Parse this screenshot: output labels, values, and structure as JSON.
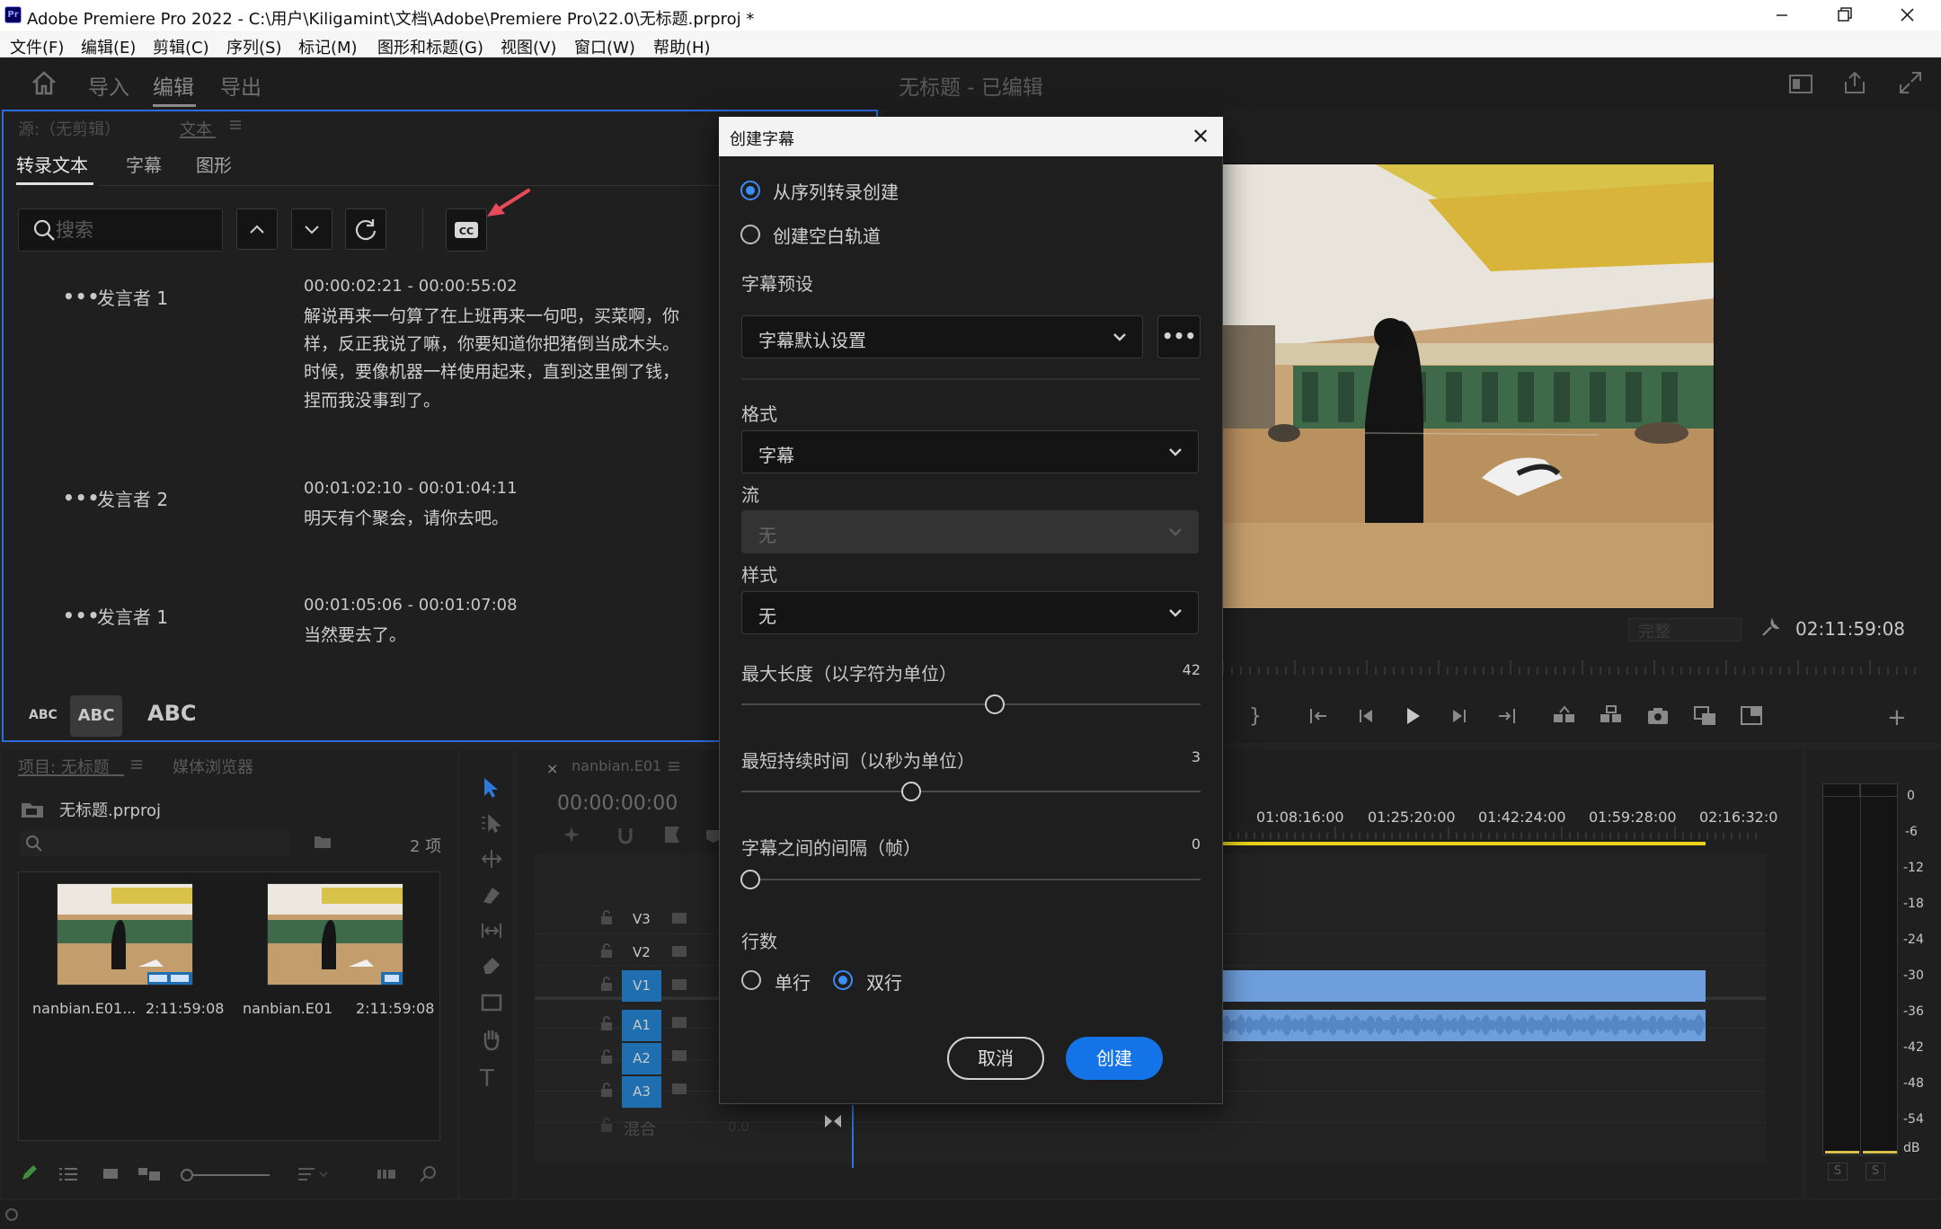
{
  "window": {
    "title": "Adobe Premiere Pro 2022 - C:\\用户\\Kiligamint\\文档\\Adobe\\Premiere Pro\\22.0\\无标题.prproj *",
    "app_icon": "Pr"
  },
  "menu": [
    "文件(F)",
    "编辑(E)",
    "剪辑(C)",
    "序列(S)",
    "标记(M)",
    "图形和标题(G)",
    "视图(V)",
    "窗口(W)",
    "帮助(H)"
  ],
  "header": {
    "tabs": [
      "导入",
      "编辑",
      "导出"
    ],
    "active_tab": "编辑",
    "doc_title": "无标题 - 已编辑"
  },
  "source_panel": {
    "tab_source": "源:（无剪辑）",
    "tab_text": "文本",
    "subtabs": [
      "转录文本",
      "字幕",
      "图形"
    ],
    "search_placeholder": "搜索",
    "entries": [
      {
        "speaker": "发言者 1",
        "timecode": "00:00:02:21 - 00:00:55:02",
        "lines": [
          "解说再来一句算了在上班再来一句吧，买菜啊，你",
          "样，反正我说了嘛，你要知道你把猪倒当成木头。",
          "时候，要像机器一样使用起来，直到这里倒了钱，",
          "捏而我没事到了。"
        ]
      },
      {
        "speaker": "发言者 2",
        "timecode": "00:01:02:10 - 00:01:04:11",
        "lines": [
          "明天有个聚会，请你去吧。"
        ]
      },
      {
        "speaker": "发言者 1",
        "timecode": "00:01:05:06 - 00:01:07:08",
        "lines": [
          "当然要去了。"
        ]
      }
    ],
    "text_sizes": [
      "ABC",
      "ABC",
      "ABC"
    ]
  },
  "project_panel": {
    "tab_project": "项目: 无标题",
    "tab_media": "媒体浏览器",
    "project_file": "无标题.prproj",
    "item_count": "2 项",
    "clips": [
      {
        "name": "nanbian.E01...",
        "duration": "2:11:59:08"
      },
      {
        "name": "nanbian.E01",
        "duration": "2:11:59:08"
      }
    ]
  },
  "timeline": {
    "sequence_name": "nanbian.E01",
    "timecode": "00:00:00:00",
    "ruler": [
      "01:08:16:00",
      "01:25:20:00",
      "01:42:24:00",
      "01:59:28:00",
      "02:16:32:0"
    ],
    "tracks": [
      "V3",
      "V2",
      "V1",
      "A1",
      "A2",
      "A3"
    ],
    "mix_label": "混合",
    "mix_value": "0.0"
  },
  "program_monitor": {
    "fit": "完整",
    "timecode": "02:11:59:08"
  },
  "audio_meter": {
    "labels": [
      "0",
      "-6",
      "-12",
      "-18",
      "-24",
      "-30",
      "-36",
      "-42",
      "-48",
      "-54",
      "dB"
    ],
    "solo": [
      "S",
      "S"
    ]
  },
  "dialog": {
    "title": "创建字幕",
    "close": "✕",
    "source_options": [
      {
        "label": "从序列转录创建",
        "selected": true
      },
      {
        "label": "创建空白轨道",
        "selected": false
      }
    ],
    "preset_label": "字幕预设",
    "preset_value": "字幕默认设置",
    "preset_more": "•••",
    "format_label": "格式",
    "format_value": "字幕",
    "stream_label": "流",
    "stream_value": "无",
    "style_label": "样式",
    "style_value": "无",
    "sliders": [
      {
        "label": "最大长度（以字符为单位）",
        "value": "42",
        "position": 0.56
      },
      {
        "label": "最短持续时间（以秒为单位）",
        "value": "3",
        "position": 0.37
      },
      {
        "label": "字幕之间的间隔（帧）",
        "value": "0",
        "position": 0.0
      }
    ],
    "lines_label": "行数",
    "line_options": [
      {
        "label": "单行",
        "selected": false
      },
      {
        "label": "双行",
        "selected": true
      }
    ],
    "cancel": "取消",
    "create": "创建"
  },
  "colors": {
    "accent": "#1473e6",
    "focus_border": "#2d6cdf",
    "track_highlight": "#1f6fb0",
    "clip_blue": "#6e9fdc",
    "playhead_yellow": "#e8d21a",
    "annotation_arrow": "#e74b5a"
  }
}
